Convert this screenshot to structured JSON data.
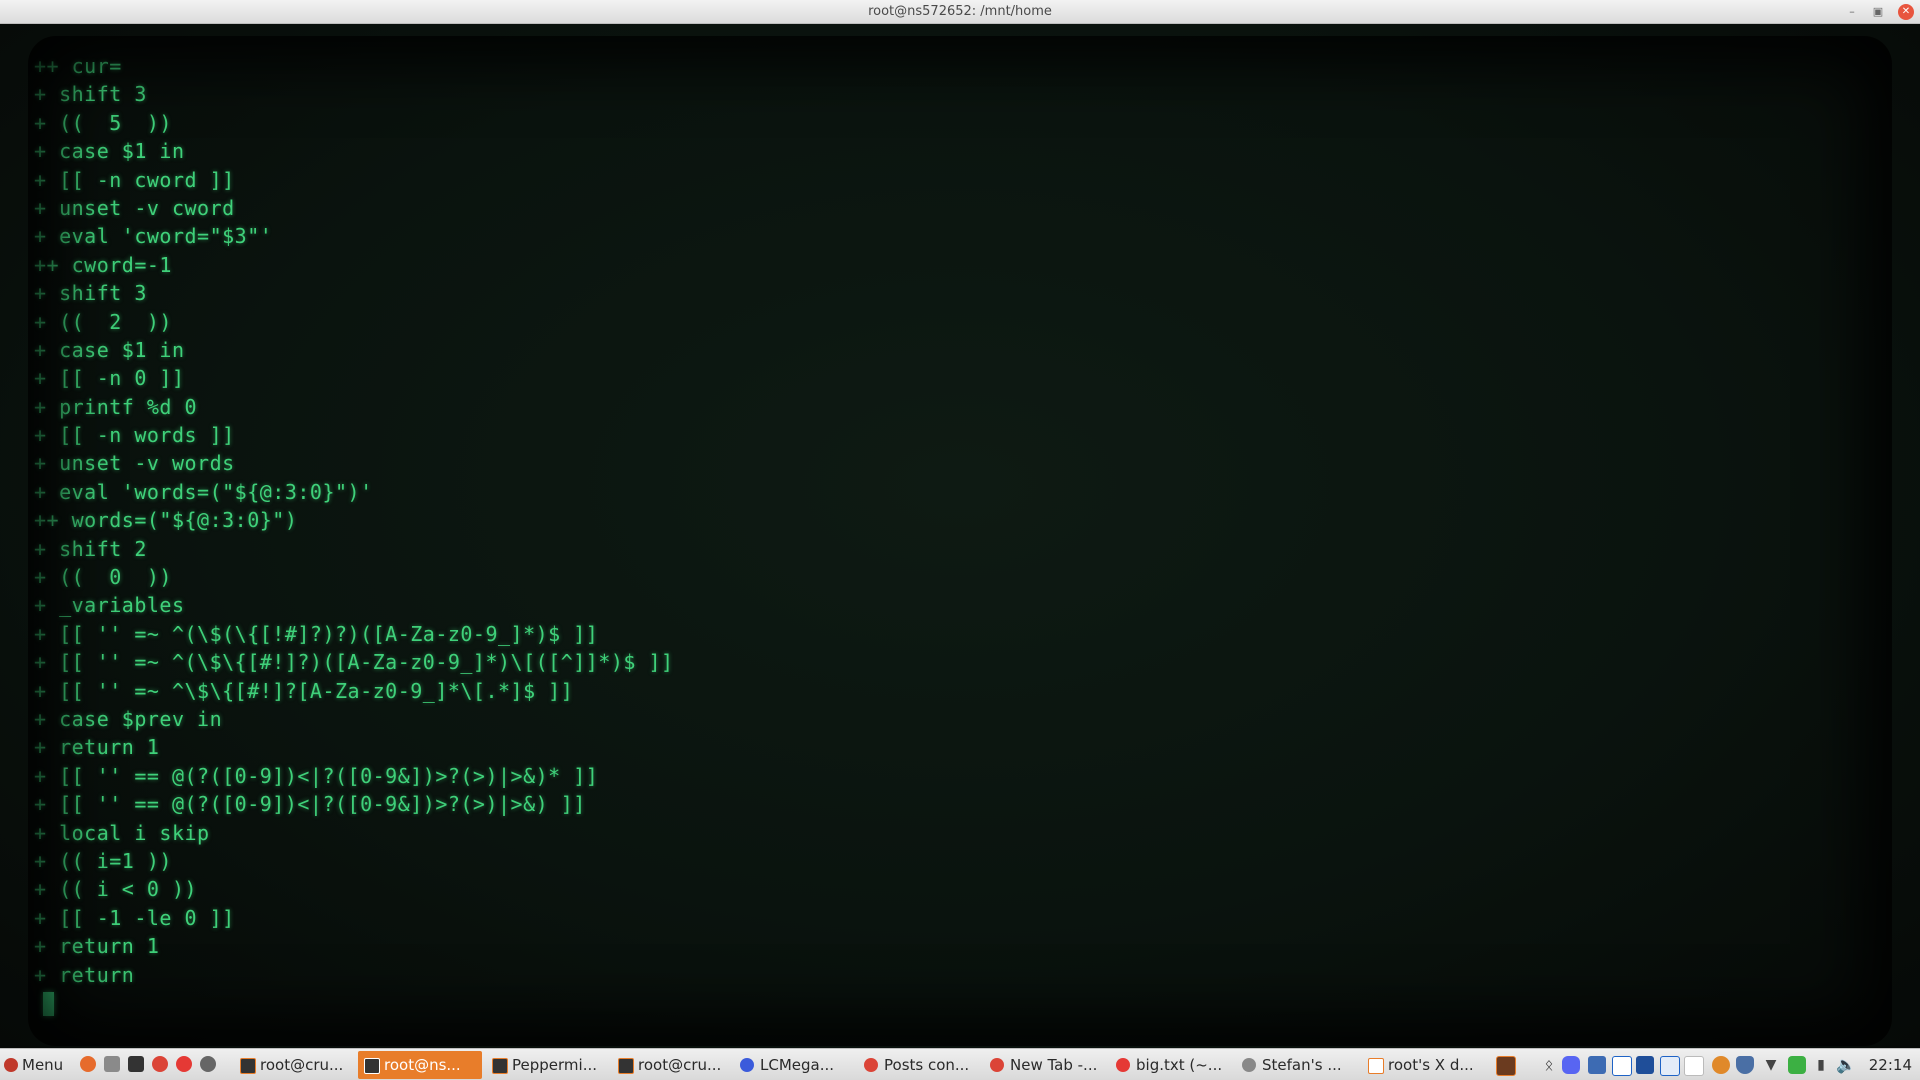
{
  "window": {
    "title": "root@ns572652: /mnt/home"
  },
  "terminal": {
    "lines": [
      "++ cur=",
      "+ shift 3",
      "+ ((  5  ))",
      "+ case $1 in",
      "+ [[ -n cword ]]",
      "+ unset -v cword",
      "+ eval 'cword=\"$3\"'",
      "++ cword=-1",
      "+ shift 3",
      "+ ((  2  ))",
      "+ case $1 in",
      "+ [[ -n 0 ]]",
      "+ printf %d 0",
      "+ [[ -n words ]]",
      "+ unset -v words",
      "+ eval 'words=(\"${@:3:0}\")'",
      "++ words=(\"${@:3:0}\")",
      "+ shift 2",
      "+ ((  0  ))",
      "+ _variables",
      "+ [[ '' =~ ^(\\$(\\{[!#]?)?)([A-Za-z0-9_]*)$ ]]",
      "+ [[ '' =~ ^(\\$\\{[#!]?)([A-Za-z0-9_]*)\\[([^]]*)$ ]]",
      "+ [[ '' =~ ^\\$\\{[#!]?[A-Za-z0-9_]*\\[.*]$ ]]",
      "+ case $prev in",
      "+ return 1",
      "+ [[ '' == @(?([0-9])<|?([0-9&])>?(>)|>&)* ]]",
      "+ [[ '' == @(?([0-9])<|?([0-9&])>?(>)|>&) ]]",
      "+ local i skip",
      "+ (( i=1 ))",
      "+ (( i < 0 ))",
      "+ [[ -1 -le 0 ]]",
      "+ return 1",
      "+ return"
    ],
    "text_color": "#3fd17a"
  },
  "taskbar": {
    "menu_label": "Menu",
    "tasks": [
      {
        "label": "root@cru...",
        "icon": "terminal-icon",
        "active": false
      },
      {
        "label": "root@ns...",
        "icon": "terminal-icon",
        "active": true
      },
      {
        "label": "Peppermi...",
        "icon": "terminal-icon",
        "active": false
      },
      {
        "label": "root@cru...",
        "icon": "terminal-icon",
        "active": false
      },
      {
        "label": "LCMega...",
        "icon": "firefox-icon",
        "active": false
      },
      {
        "label": "Posts con...",
        "icon": "chrome-icon",
        "active": false
      },
      {
        "label": "New Tab -...",
        "icon": "chrome-icon",
        "active": false
      },
      {
        "label": "big.txt (~...",
        "icon": "editor-icon",
        "active": false
      },
      {
        "label": "Stefan's ...",
        "icon": "app-icon",
        "active": false
      },
      {
        "label": "root's X d...",
        "icon": "file-icon",
        "active": false
      }
    ],
    "clock": "22:14",
    "accent_color": "#e87d2a"
  }
}
